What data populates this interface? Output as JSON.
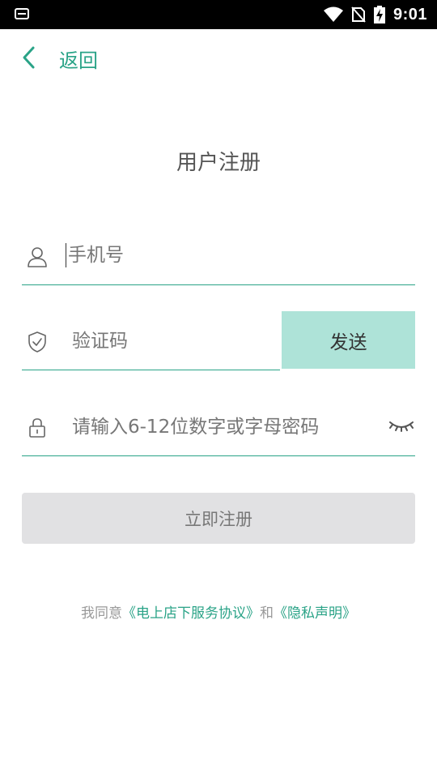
{
  "status_bar": {
    "time": "9:01"
  },
  "nav": {
    "back_label": "返回"
  },
  "page": {
    "title": "用户注册"
  },
  "form": {
    "phone_placeholder": "手机号",
    "code_placeholder": "验证码",
    "send_label": "发送",
    "password_placeholder": "请输入6-12位数字或字母密码",
    "register_label": "立即注册"
  },
  "agreement": {
    "prefix": "我同意",
    "terms_link": "《电上店下服务协议》",
    "and": "和",
    "privacy_link": "《隐私声明》"
  },
  "colors": {
    "accent": "#2aa387",
    "send_bg": "#aee3d8",
    "register_bg": "#e1e1e3"
  },
  "icons": [
    "app-icon",
    "wifi-icon",
    "no-sim-icon",
    "battery-charging-icon",
    "back-chevron-icon",
    "user-icon",
    "shield-check-icon",
    "lock-icon",
    "eye-closed-icon"
  ]
}
